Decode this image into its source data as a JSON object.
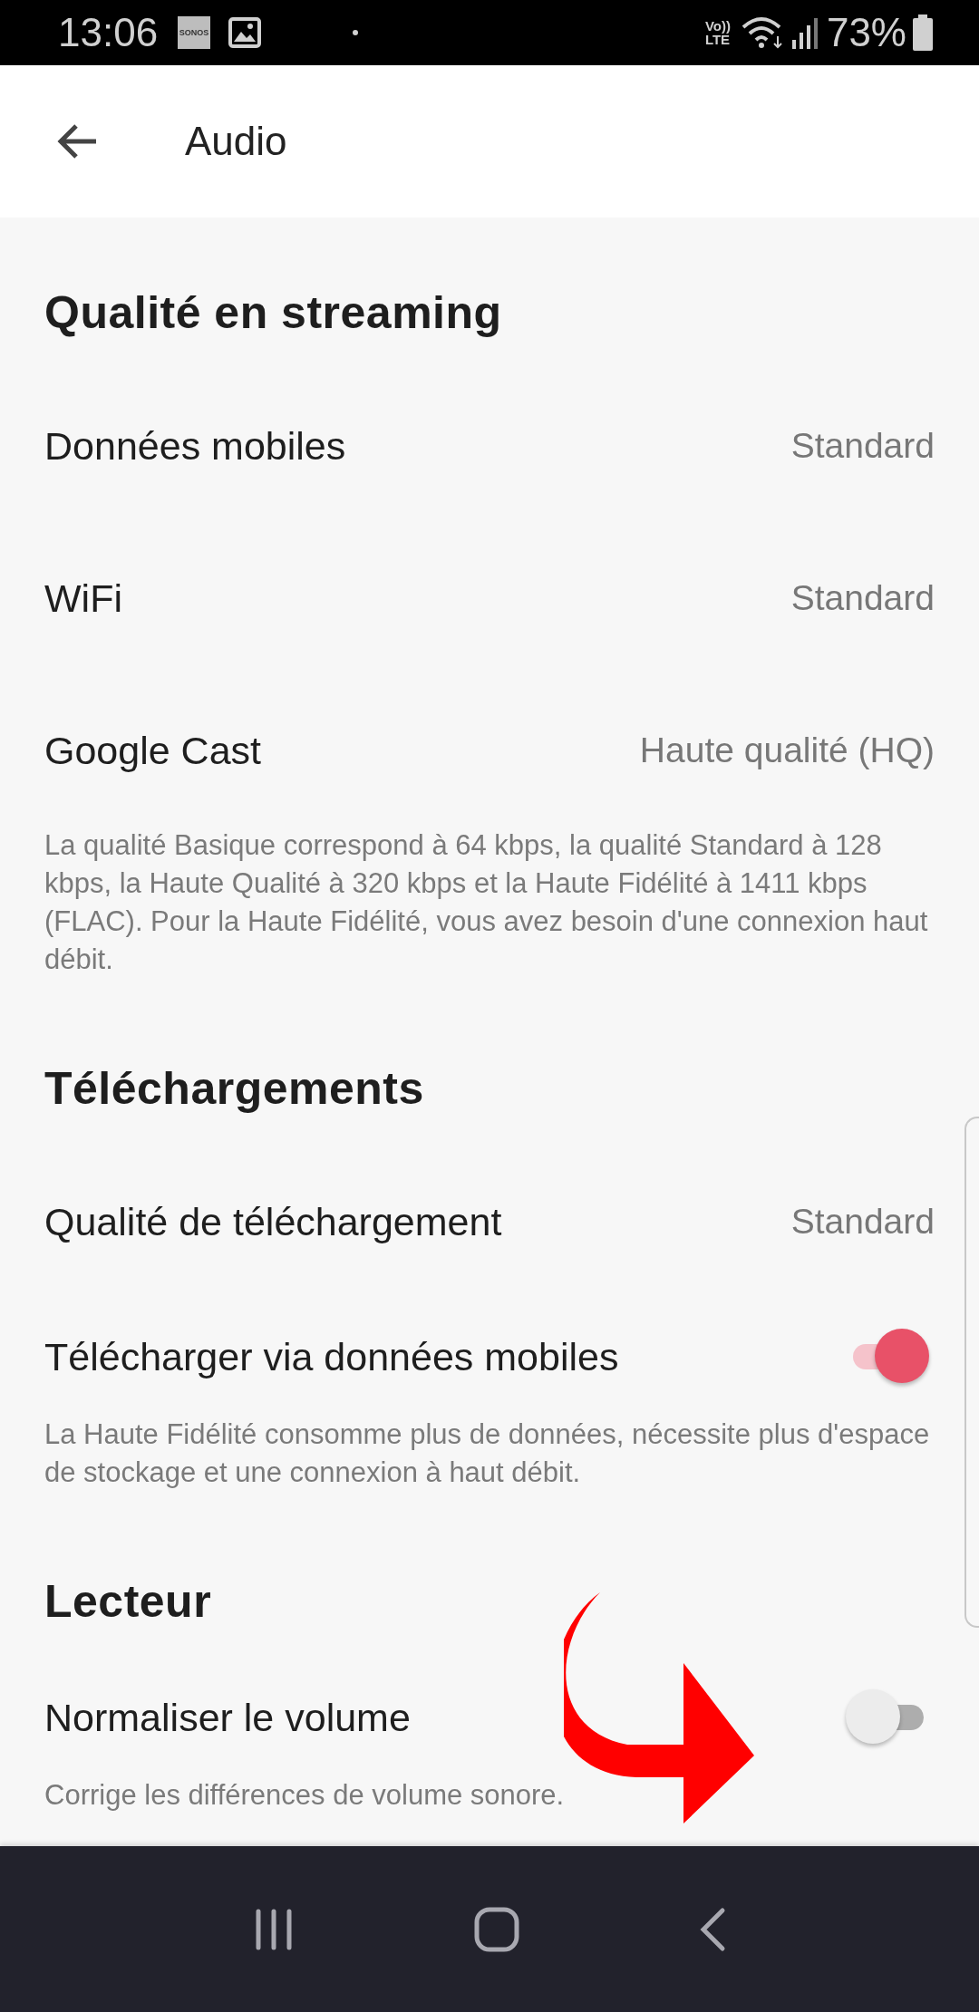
{
  "status_bar": {
    "time": "13:06",
    "notification_app": "SONOS",
    "volte": "Vo))",
    "network": "LTE",
    "battery": "73%"
  },
  "app_bar": {
    "title": "Audio"
  },
  "sections": [
    {
      "title": "Qualité en streaming",
      "items": [
        {
          "kind": "value",
          "label": "Données mobiles",
          "value": "Standard"
        },
        {
          "kind": "value",
          "label": "WiFi",
          "value": "Standard"
        },
        {
          "kind": "value",
          "label": "Google Cast",
          "value": "Haute qualité (HQ)"
        }
      ],
      "note": "La qualité Basique correspond à 64 kbps, la qualité Standard à 128 kbps, la Haute Qualité à 320 kbps et la Haute Fidélité à 1411 kbps (FLAC). Pour la Haute Fidélité, vous avez besoin d'une connexion haut débit."
    },
    {
      "title": "Téléchargements",
      "items": [
        {
          "kind": "value",
          "label": "Qualité de téléchargement",
          "value": "Standard"
        },
        {
          "kind": "toggle",
          "label": "Télécharger via données mobiles",
          "on": true
        }
      ],
      "note": "La Haute Fidélité consomme plus de données, nécessite plus d'espace de stockage et une connexion à haut débit."
    },
    {
      "title": "Lecteur",
      "items": [
        {
          "kind": "toggle",
          "label": "Normaliser le volume",
          "on": false
        }
      ],
      "note": "Corrige les différences de volume sonore."
    }
  ]
}
